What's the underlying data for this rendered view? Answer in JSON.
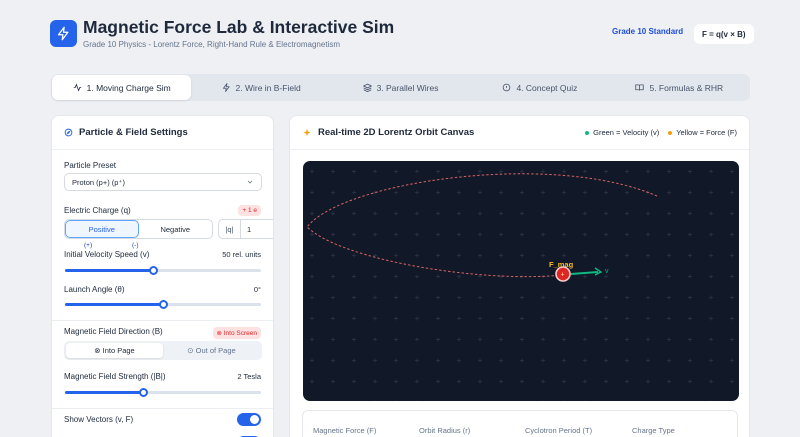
{
  "header": {
    "title": "Magnetic Force Lab & Interactive Sim",
    "subtitle": "Grade 10 Physics - Lorentz Force, Right-Hand Rule & Electromagnetism",
    "badge": "Grade 10 Standard",
    "formula": "F = q(v × B)",
    "logo_icon": "bolt-icon"
  },
  "tabs": [
    {
      "label": "1. Moving Charge Sim",
      "icon": "activity-icon",
      "active": true
    },
    {
      "label": "2. Wire in B-Field",
      "icon": "bolt-icon"
    },
    {
      "label": "3. Parallel Wires",
      "icon": "layers-icon"
    },
    {
      "label": "4. Concept Quiz",
      "icon": "info-icon"
    },
    {
      "label": "5. Formulas & RHR",
      "icon": "book-icon"
    }
  ],
  "settings": {
    "title": "Particle & Field Settings",
    "preset_label": "Particle Preset",
    "preset_value": "Proton (p+) (p⁺)",
    "charge_label": "Electric Charge (q)",
    "charge_badge": "+ 1 e",
    "positive_label": "Positive",
    "positive_sub": "(+)",
    "negative_label": "Negative",
    "negative_sub": "(-)",
    "q_label": "|q|",
    "q_value": "1",
    "speed_label": "Initial Velocity Speed (v)",
    "speed_value": "50 rel. units",
    "speed_fraction": 0.45,
    "angle_label": "Launch Angle (θ)",
    "angle_value": "0°",
    "angle_fraction": 0.5,
    "direction_label": "Magnetic Field Direction (B)",
    "direction_badge": "⊗ Into Screen",
    "into_label": "⊗ Into Page",
    "out_label": "⊙ Out of Page",
    "strength_label": "Magnetic Field Strength (|B|)",
    "strength_value": "2 Tesla",
    "strength_fraction": 0.4,
    "vectors_label": "Show Vectors (v, F)",
    "vectors_on": true
  },
  "canvas": {
    "title": "Real-time 2D Lorentz Orbit Canvas",
    "legend_velocity": "Green = Velocity (v)",
    "legend_force": "Yellow = Force (F)",
    "velocity_color": "#10b981",
    "force_color": "#f59e0b",
    "force_label": "F_mag",
    "velocity_label": "v",
    "particle_label": "+"
  },
  "stats": {
    "force": "Magnetic Force (F)",
    "radius": "Orbit Radius (r)",
    "period": "Cyclotron Period (T)",
    "charge_type": "Charge Type"
  }
}
